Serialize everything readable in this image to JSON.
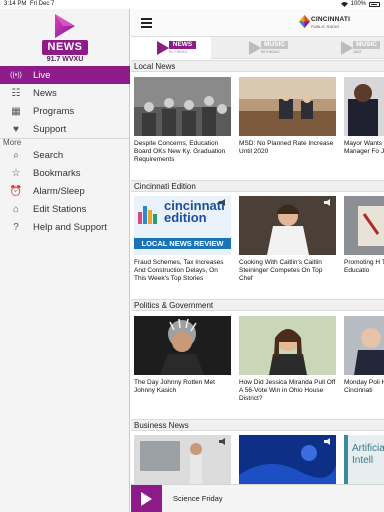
{
  "status": {
    "time": "3:14 PM",
    "date": "Fri Dec 7",
    "battery": "100%"
  },
  "brand": {
    "news": "NEWS",
    "callsign": "91.7 WVXU"
  },
  "nav_main": [
    {
      "label": "Live",
      "icon": "broadcast-icon",
      "glyph": "((•))"
    },
    {
      "label": "News",
      "icon": "newspaper-icon",
      "glyph": "☷"
    },
    {
      "label": "Programs",
      "icon": "calendar-icon",
      "glyph": "▦"
    },
    {
      "label": "Support",
      "icon": "support-icon",
      "glyph": "♥"
    }
  ],
  "nav_more_label": "More",
  "nav_more": [
    {
      "label": "Search",
      "icon": "search-icon",
      "glyph": "⌕"
    },
    {
      "label": "Bookmarks",
      "icon": "star-icon",
      "glyph": "☆"
    },
    {
      "label": "Alarm/Sleep",
      "icon": "alarm-clock-icon",
      "glyph": "⏰"
    },
    {
      "label": "Edit Stations",
      "icon": "home-icon",
      "glyph": "⌂"
    },
    {
      "label": "Help and Support",
      "icon": "help-icon",
      "glyph": "?"
    }
  ],
  "header": {
    "logo_name": "CINCINNATI",
    "logo_sub": "PUBLIC RADIO"
  },
  "stations": [
    {
      "label": "NEWS",
      "call": "91.7 WVXU"
    },
    {
      "label": "MUSIC",
      "call": "90.9 WGUC"
    },
    {
      "label": "MUSIC",
      "call": "JAZZ"
    }
  ],
  "sections": [
    {
      "title": "Local News",
      "items": [
        {
          "caption": "Despite Concerns, Education Board OKs New Ky. Graduation Requirements"
        },
        {
          "caption": "MSD: No Planned Rate Increase Until 2020"
        },
        {
          "caption": "Mayor Wants 'Thorough' Manager Fo Job"
        }
      ]
    },
    {
      "title": "Cincinnati Edition",
      "items": [
        {
          "caption": "Fraud Schemes, Tax Increases And Construction Delays, On This Week's Top Stories",
          "thumb_title": "cincinnati edition",
          "thumb_banner": "LOCAL NEWS REVIEW"
        },
        {
          "caption": "Cooking With Caitlin's Caitlin Steininger Competes On Top Chef"
        },
        {
          "caption": "Promoting H Through Dia And Educatio"
        }
      ]
    },
    {
      "title": "Politics & Government",
      "items": [
        {
          "caption": "The Day Johnny Rotten Met Johnny Kasich"
        },
        {
          "caption": "How Did Jessica Miranda Pull Off A 56-Vote Win in Ohio House District?"
        },
        {
          "caption": "Monday Poli H.W. Bush's Cincinnati"
        }
      ]
    },
    {
      "title": "Business News",
      "items": [
        {
          "caption": ""
        },
        {
          "caption": ""
        },
        {
          "caption": "",
          "thumb_text": "Artificial Intell"
        }
      ]
    }
  ],
  "player": {
    "title": "Science Friday"
  },
  "colors": {
    "accent": "#8d1b89"
  }
}
